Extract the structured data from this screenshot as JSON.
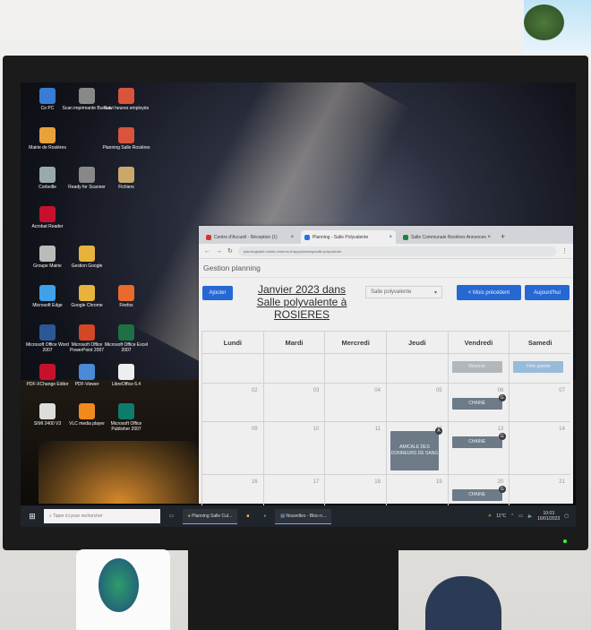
{
  "desktop": {
    "icons": [
      {
        "label": "Ce PC"
      },
      {
        "label": "Scan imprimante Bureau"
      },
      {
        "label": "Suivi heures employés"
      },
      {
        "label": "Mairie de Rosières"
      },
      {
        "label": "Planning Salle Rosières"
      },
      {
        "label": "Corbeille"
      },
      {
        "label": "Ready for Scanner"
      },
      {
        "label": "Fichiers"
      },
      {
        "label": "Acrobat Reader"
      },
      {
        "label": "Groupe Mairie"
      },
      {
        "label": "Gestion Google"
      },
      {
        "label": "Microsoft Edge"
      },
      {
        "label": "Google Chrome"
      },
      {
        "label": "Firefox"
      },
      {
        "label": "Microsoft Office Word 2007"
      },
      {
        "label": "Microsoft Office PowerPoint 2007"
      },
      {
        "label": "Microsoft Office Excel 2007"
      },
      {
        "label": "PDF-XChange Editor"
      },
      {
        "label": "PDF-Viewer"
      },
      {
        "label": "LibreOffice 6.4"
      },
      {
        "label": "SIMI 2400 V3"
      },
      {
        "label": "VLC media player"
      },
      {
        "label": "Microsoft Office Publisher 2007"
      }
    ]
  },
  "browser": {
    "tabs": [
      {
        "label": "Centre d'Accueil - Réception (1)",
        "color": "#d93025"
      },
      {
        "label": "Planning - Salle Polyvalente",
        "color": "#1a73e8"
      },
      {
        "label": "Salle Communale Rosières Annonces",
        "color": "#188038"
      }
    ],
    "new_tab_label": "+",
    "url": "planningsalle.mairie-rosieres.fr/app/planning/salle-polyvalente"
  },
  "app": {
    "header": "Gestion planning",
    "add_button": "Ajouter",
    "calendar_title": "Janvier 2023 dans Salle polyvalente à ROSIERES",
    "room_select": "Salle polyvalente",
    "prev_month_button": "< Mois précédent",
    "today_button": "Aujourd'hui"
  },
  "calendar": {
    "weekdays": [
      "Lundi",
      "Mardi",
      "Mercredi",
      "Jeudi",
      "Vendredi",
      "Samedi"
    ],
    "weeks": [
      {
        "days": [
          "",
          "",
          "",
          "",
          "",
          ""
        ]
      },
      {
        "days": [
          "02",
          "03",
          "04",
          "05",
          "06",
          "07"
        ]
      },
      {
        "days": [
          "09",
          "10",
          "11",
          "12",
          "13",
          "14"
        ]
      },
      {
        "days": [
          "16",
          "17",
          "18",
          "19",
          "20",
          "21"
        ]
      }
    ],
    "events": [
      {
        "label": "Réservé",
        "week": 0,
        "day": 4,
        "style": "grey"
      },
      {
        "label": "Fête galette",
        "week": 0,
        "day": 5,
        "style": "light"
      },
      {
        "label": "CHAINE",
        "week": 1,
        "day": 4,
        "style": "dark",
        "badge": "G"
      },
      {
        "label": "AMICALE DES DONNEURS DE SANG",
        "week": 2,
        "day": 3,
        "style": "dark",
        "badge": "A"
      },
      {
        "label": "CHAINE",
        "week": 2,
        "day": 4,
        "style": "dark",
        "badge": "G"
      },
      {
        "label": "CHAINE",
        "week": 3,
        "day": 4,
        "style": "dark",
        "badge": "G"
      }
    ]
  },
  "taskbar": {
    "search_placeholder": "Taper ici pour rechercher",
    "items": [
      {
        "label": "Planning Salle Cul..."
      },
      {
        "label": "Nouvelles - Bloc-n..."
      }
    ],
    "weather": "11°C",
    "time": "10:03",
    "date": "16/01/2023"
  }
}
